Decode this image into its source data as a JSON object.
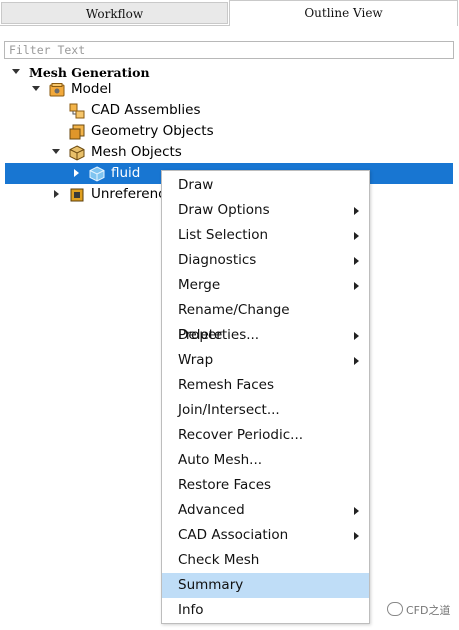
{
  "tabs": [
    {
      "label": "Workflow",
      "active": false
    },
    {
      "label": "Outline View",
      "active": true
    }
  ],
  "filter": {
    "placeholder": "Filter Text",
    "value": ""
  },
  "tree": {
    "root": "Mesh Generation",
    "model": "Model",
    "cad_assemblies": "CAD Assemblies",
    "geometry_objects": "Geometry Objects",
    "mesh_objects": "Mesh Objects",
    "fluid": "fluid",
    "unreferenced": "Unreferenc"
  },
  "context_menu": {
    "items": [
      {
        "label": "Draw",
        "submenu": false
      },
      {
        "label": "Draw Options",
        "submenu": true
      },
      {
        "label": "List Selection",
        "submenu": true
      },
      {
        "label": "Diagnostics",
        "submenu": true
      },
      {
        "label": "Merge",
        "submenu": true
      },
      {
        "label": "Rename/Change Properties...",
        "submenu": false
      },
      {
        "label": "Delete",
        "submenu": true
      },
      {
        "label": "Wrap",
        "submenu": true
      },
      {
        "label": "Remesh Faces",
        "submenu": false
      },
      {
        "label": "Join/Intersect...",
        "submenu": false
      },
      {
        "label": "Recover Periodic...",
        "submenu": false
      },
      {
        "label": "Auto Mesh...",
        "submenu": false
      },
      {
        "label": "Restore Faces",
        "submenu": false
      },
      {
        "label": "Advanced",
        "submenu": true
      },
      {
        "label": "CAD Association",
        "submenu": true
      },
      {
        "label": "Check Mesh",
        "submenu": false
      },
      {
        "label": "Summary",
        "submenu": false,
        "highlighted": true
      },
      {
        "label": "Info",
        "submenu": false
      }
    ]
  },
  "watermark": {
    "text": "CFD之道"
  },
  "colors": {
    "selection": "#1876d2",
    "menu_highlight": "#bfddf7",
    "tab_inactive": "#e9e9e9"
  }
}
